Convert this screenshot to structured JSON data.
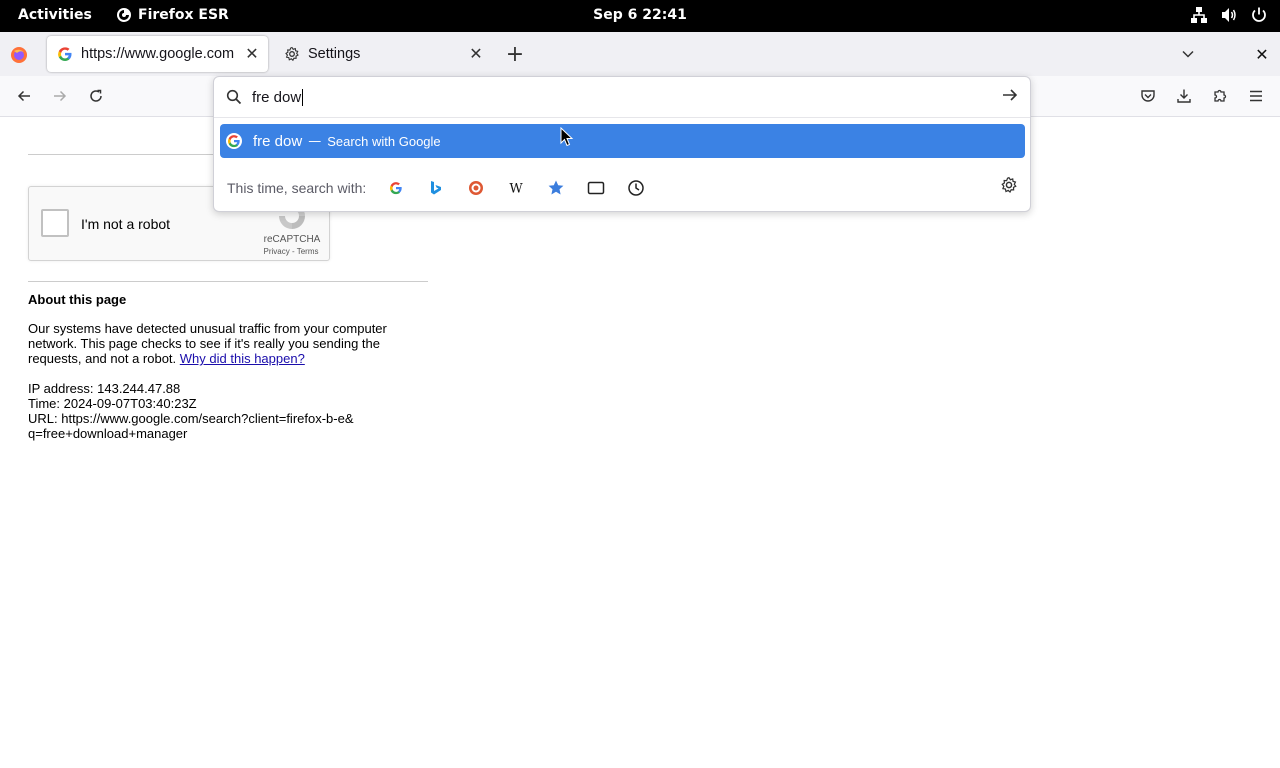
{
  "topbar": {
    "activities": "Activities",
    "app_name": "Firefox ESR",
    "clock": "Sep 6  22:41"
  },
  "tabs": [
    {
      "title": "https://www.google.com",
      "active": true
    },
    {
      "title": "Settings",
      "active": false
    }
  ],
  "urlbar": {
    "value": "fre dow",
    "result": {
      "query": "fre dow",
      "dash": "—",
      "action": "Search with Google"
    },
    "oneoff_label": "This time, search with:",
    "engines": [
      "google-icon",
      "bing-icon",
      "duckduckgo-icon",
      "wikipedia-icon",
      "bookmarks-icon",
      "tabs-icon",
      "history-icon"
    ]
  },
  "page": {
    "recaptcha_text": "I'm not a robot",
    "recaptcha_brand": "reCAPTCHA",
    "recaptcha_terms": "Privacy - Terms",
    "about_title": "About this page",
    "body_text": "Our systems have detected unusual traffic from your computer network. This page checks to see if it's really you sending the requests, and not a robot. ",
    "why_link": "Why did this happen?",
    "ip": "IP address: 143.244.47.88",
    "time": "Time: 2024-09-07T03:40:23Z",
    "url_line1": "URL: https://www.google.com/search?client=firefox-b-e&",
    "url_line2": "q=free+download+manager"
  },
  "colors": {
    "highlight": "#3b82e4",
    "link": "#1a0dab",
    "topbar": "#000000"
  }
}
